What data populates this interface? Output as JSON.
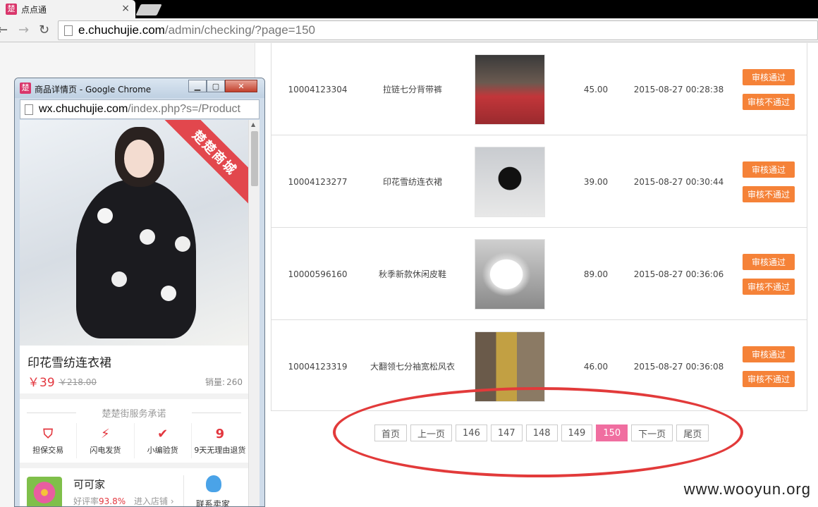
{
  "browser": {
    "tab_title": "点点通",
    "tab_favicon": "楚",
    "url_host": "e.chuchujie.com",
    "url_path": "/admin/checking/?page=150"
  },
  "products": [
    {
      "id": "10004123304",
      "name": "拉链七分背带裤",
      "price": "45.00",
      "time": "2015-08-27 00:28:38"
    },
    {
      "id": "10004123277",
      "name": "印花雪纺连衣裙",
      "price": "39.00",
      "time": "2015-08-27 00:30:44"
    },
    {
      "id": "10000596160",
      "name": "秋季新款休闲皮鞋",
      "price": "89.00",
      "time": "2015-08-27 00:36:06"
    },
    {
      "id": "10004123319",
      "name": "大翻领七分袖宽松风衣",
      "price": "46.00",
      "time": "2015-08-27 00:36:08"
    }
  ],
  "actions": {
    "approve": "审核通过",
    "reject": "审核不通过"
  },
  "pagination": {
    "first": "首页",
    "prev": "上一页",
    "pages": [
      "146",
      "147",
      "148",
      "149",
      "150"
    ],
    "current": "150",
    "next": "下一页",
    "last": "尾页"
  },
  "watermark": "www.wooyun.org",
  "popup": {
    "title": "商品详情页 - Google Chrome",
    "favicon": "楚",
    "url_host": "wx.chuchujie.com",
    "url_path": "/index.php?s=/Product",
    "ribbon": "楚楚商城",
    "product_name": "印花雪纺连衣裙",
    "price": "￥39",
    "old_price": "￥218.00",
    "sales_label": "销量:",
    "sales_value": "260",
    "service_title": "楚楚街服务承诺",
    "services": [
      {
        "icon": "shield-icon",
        "glyph": "⛉",
        "label": "担保交易"
      },
      {
        "icon": "lightning-icon",
        "glyph": "⚡",
        "label": "闪电发货"
      },
      {
        "icon": "check-icon",
        "glyph": "✔",
        "label": "小编验货"
      },
      {
        "icon": "nine-days-icon",
        "glyph": "9",
        "label": "9天无理由退货"
      }
    ],
    "shop_name": "可可家",
    "shop_rate_label": "好评率",
    "shop_rate_value": "93.8%",
    "enter_shop": "进入店铺",
    "contact_seller": "联系卖家"
  },
  "colors": {
    "accent_button": "#f58238",
    "pager_active": "#f06ea0",
    "price_red": "#e3373f",
    "annotation_red": "#e23a3a"
  }
}
